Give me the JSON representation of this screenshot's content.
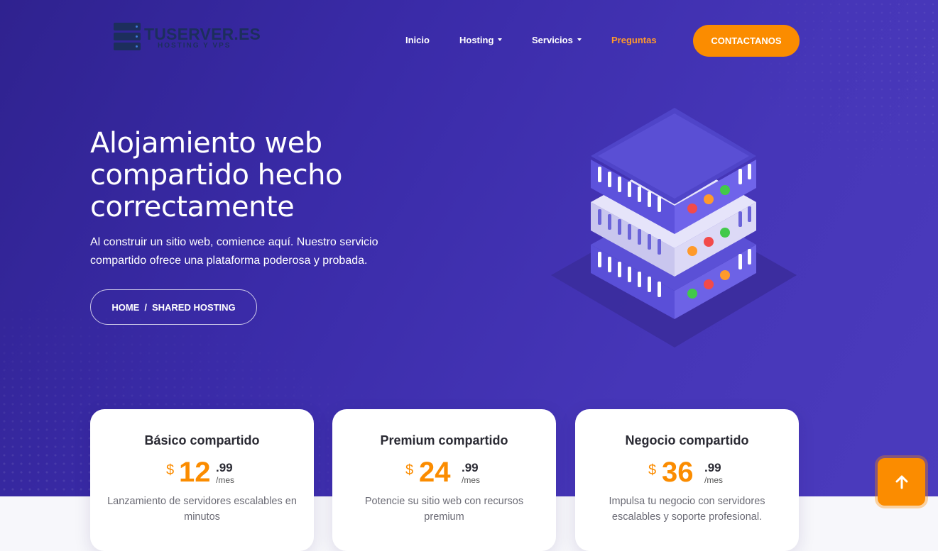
{
  "header": {
    "logo_name": "TUSERVER.ES",
    "logo_tagline": "HOSTING Y VPS",
    "nav": {
      "inicio": "Inicio",
      "hosting": "Hosting",
      "servicios": "Servicios",
      "preguntas": "Preguntas"
    },
    "contact_label": "CONTACTANOS"
  },
  "hero": {
    "title_line1": "Alojamiento web",
    "title_line2": "compartido hecho",
    "title_line3": "correctamente",
    "subtitle": "Al construir un sitio web, comience aquí. Nuestro servicio compartido ofrece una plataforma poderosa y probada.",
    "breadcrumb": {
      "home": "HOME",
      "separator": "/",
      "current": "SHARED HOSTING"
    }
  },
  "plans": [
    {
      "title": "Básico compartido",
      "currency": "$",
      "price_int": "12",
      "price_dec": ".99",
      "period": "/mes",
      "description": "Lanzamiento de servidores escalables en minutos"
    },
    {
      "title": "Premium compartido",
      "currency": "$",
      "price_int": "24",
      "price_dec": ".99",
      "period": "/mes",
      "description": "Potencie su sitio web con recursos premium"
    },
    {
      "title": "Negocio compartido",
      "currency": "$",
      "price_int": "36",
      "price_dec": ".99",
      "period": "/mes",
      "description": "Impulsa tu negocio con servidores escalables y soporte profesional."
    }
  ],
  "colors": {
    "accent": "#fb8c00",
    "hero_bg": "#3a2ba8",
    "logo": "#1c2e5c"
  },
  "icons": {
    "logo": "server-stack-icon",
    "scroll_top": "arrow-up-icon",
    "dropdown": "caret-down-icon"
  }
}
